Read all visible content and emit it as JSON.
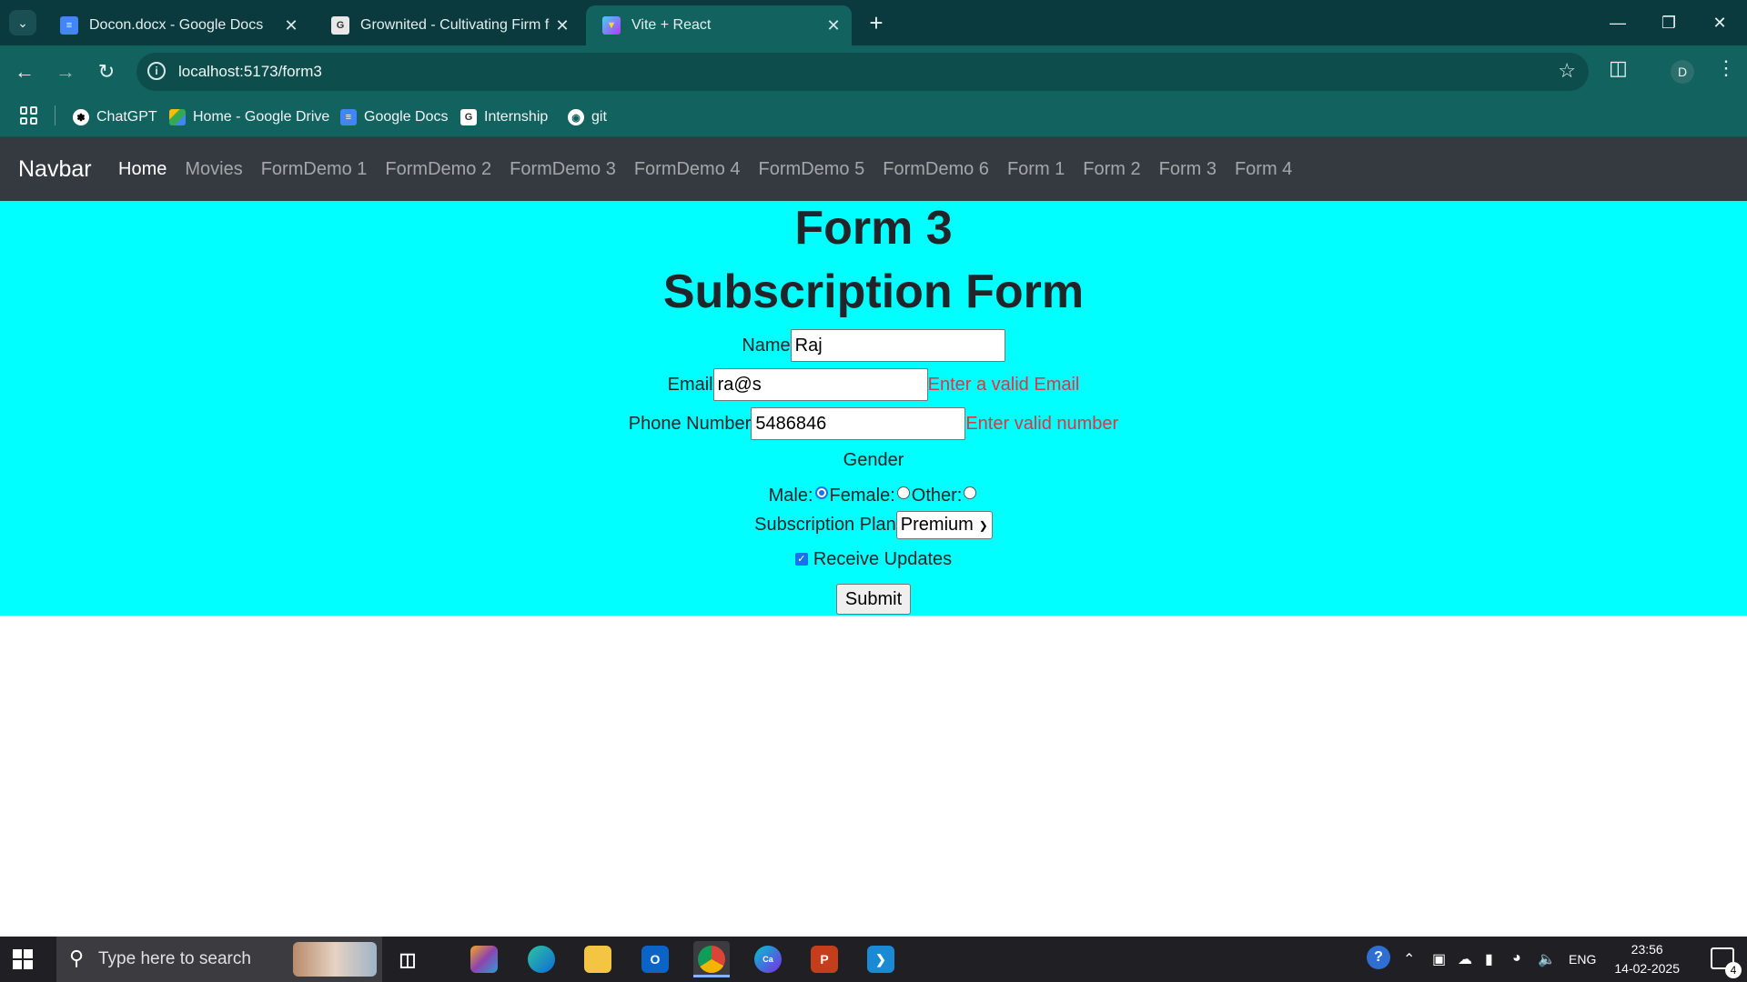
{
  "browser": {
    "tabs": [
      {
        "title": "Docon.docx - Google Docs",
        "icon": "google-docs-icon",
        "active": false
      },
      {
        "title": "Grownited - Cultivating Firm for",
        "icon": "grownited-icon",
        "active": false
      },
      {
        "title": "Vite + React",
        "icon": "vite-icon",
        "active": true
      }
    ],
    "url": "localhost:5173/form3",
    "profile_initial": "D",
    "bookmarks": [
      {
        "label": "ChatGPT",
        "icon": "chatgpt-icon"
      },
      {
        "label": "Home - Google Drive",
        "icon": "google-drive-icon"
      },
      {
        "label": "Google Docs",
        "icon": "google-docs-icon"
      },
      {
        "label": "Internship",
        "icon": "internship-icon"
      },
      {
        "label": "git",
        "icon": "github-icon"
      }
    ]
  },
  "navbar": {
    "brand": "Navbar",
    "links": [
      "Home",
      "Movies",
      "FormDemo 1",
      "FormDemo 2",
      "FormDemo 3",
      "FormDemo 4",
      "FormDemo 5",
      "FormDemo 6",
      "Form 1",
      "Form 2",
      "Form 3",
      "Form 4"
    ],
    "active_link": "Home"
  },
  "form": {
    "heading": "Form 3",
    "subheading": "Subscription Form",
    "name": {
      "label": "Name",
      "value": "Raj"
    },
    "email": {
      "label": "Email",
      "value": "ra@s",
      "error": "Enter a valid Email"
    },
    "phone": {
      "label": "Phone Number",
      "value": "5486846",
      "error": "Enter valid number"
    },
    "gender": {
      "label": "Gender",
      "options": [
        "Male:",
        "Female:",
        "Other:"
      ],
      "selected": "Male"
    },
    "plan": {
      "label": "Subscription Plan",
      "selected": "Premium"
    },
    "updates": {
      "label": "Receive Updates",
      "checked": true
    },
    "submit_label": "Submit"
  },
  "taskbar": {
    "search_placeholder": "Type here to search",
    "language": "ENG",
    "time": "23:56",
    "date": "14-02-2025",
    "notification_count": "4"
  },
  "colors": {
    "form_background": "#00ffff",
    "navbar_background": "#343a40",
    "error_text": "#dc3545",
    "browser_frame": "#12625f"
  }
}
